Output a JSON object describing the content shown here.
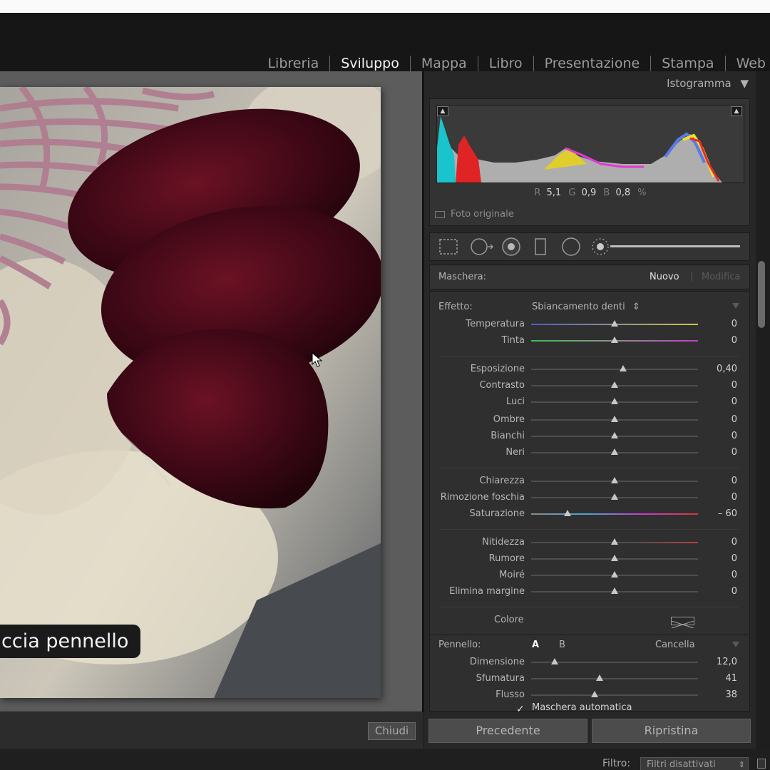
{
  "modules": [
    "Libreria",
    "Sviluppo",
    "Mappa",
    "Libro",
    "Presentazione",
    "Stampa",
    "Web"
  ],
  "active_module": "Sviluppo",
  "histogram": {
    "title": "Istogramma",
    "r_label": "R",
    "r_value": "5,1",
    "g_label": "G",
    "g_value": "0,9",
    "b_label": "B",
    "b_value": "0,8",
    "percent": "%",
    "original_label": "Foto originale"
  },
  "mask": {
    "label": "Maschera:",
    "new_label": "Nuovo",
    "edit_label": "Modifica"
  },
  "effect": {
    "label": "Effetto:",
    "preset": "Sbiancamento denti"
  },
  "sliders": [
    {
      "name": "Temperatura",
      "value": "0",
      "level": 0.5
    },
    {
      "name": "Tinta",
      "value": "0",
      "level": 0.5
    },
    {
      "name": "Esposizione",
      "value": "0,40",
      "level": 0.55
    },
    {
      "name": "Contrasto",
      "value": "0",
      "level": 0.5
    },
    {
      "name": "Luci",
      "value": "0",
      "level": 0.5
    },
    {
      "name": "Ombre",
      "value": "0",
      "level": 0.5
    },
    {
      "name": "Bianchi",
      "value": "0",
      "level": 0.5
    },
    {
      "name": "Neri",
      "value": "0",
      "level": 0.5
    },
    {
      "name": "Chiarezza",
      "value": "0",
      "level": 0.5
    },
    {
      "name": "Rimozione foschia",
      "value": "0",
      "level": 0.5
    },
    {
      "name": "Saturazione",
      "value": "– 60",
      "level": 0.22
    },
    {
      "name": "Nitidezza",
      "value": "0",
      "level": 0.5
    },
    {
      "name": "Rumore",
      "value": "0",
      "level": 0.5
    },
    {
      "name": "Moiré",
      "value": "0",
      "level": 0.5
    },
    {
      "name": "Elimina margine",
      "value": "0",
      "level": 0.5
    }
  ],
  "color": {
    "label": "Colore"
  },
  "brush": {
    "label": "Pennello:",
    "a": "A",
    "b": "B",
    "erase": "Cancella",
    "sliders": [
      {
        "name": "Dimensione",
        "value": "12,0",
        "level": 0.14
      },
      {
        "name": "Sfumatura",
        "value": "41",
        "level": 0.41
      },
      {
        "name": "Flusso",
        "value": "38",
        "level": 0.38
      }
    ],
    "auto_mask": "Maschera automatica"
  },
  "photo_overlay": "ccia pennello",
  "buttons": {
    "close": "Chiudi",
    "previous": "Precedente",
    "reset": "Ripristina"
  },
  "filter": {
    "label": "Filtro:",
    "value": "Filtri disattivati"
  },
  "colors": {
    "accent_track": "#4e4e4e",
    "panel": "#2f2f2f",
    "text": "#b6b6b6"
  }
}
